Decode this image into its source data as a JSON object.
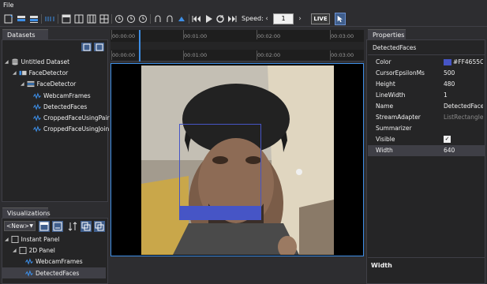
{
  "menu": {
    "file": "File"
  },
  "toolbar": {
    "speed_label": "Speed:",
    "speed_value": "1",
    "live_label": "LIVE"
  },
  "datasets_panel": {
    "tab": "Datasets",
    "tree": [
      {
        "label": "Untitled Dataset",
        "icon": "database-icon"
      },
      {
        "label": "FaceDetector",
        "icon": "session-icon"
      },
      {
        "label": "FaceDetector",
        "icon": "partition-icon"
      },
      {
        "label": "WebcamFrames",
        "icon": "stream-icon"
      },
      {
        "label": "DetectedFaces",
        "icon": "stream-icon"
      },
      {
        "label": "CroppedFaceUsingPair",
        "icon": "stream-icon"
      },
      {
        "label": "CroppedFaceUsingJoin",
        "icon": "stream-icon"
      }
    ]
  },
  "visualizations_panel": {
    "tab": "Visualizations",
    "new_dropdown": "<New>",
    "tree": [
      {
        "label": "Instant Panel"
      },
      {
        "label": "2D Panel"
      },
      {
        "label": "WebcamFrames"
      },
      {
        "label": "DetectedFaces"
      }
    ]
  },
  "timeline": {
    "top_ticks": [
      "00:00:00",
      "00:01:00",
      "00:02:00",
      "00:03:00"
    ],
    "bottom_ticks": [
      "00:00:00",
      "00:01:00",
      "00:02:00",
      "00:03:00"
    ]
  },
  "properties_panel": {
    "tab": "Properties",
    "object": "DetectedFaces",
    "rows": [
      {
        "key": "Color",
        "value": "#FF4655C6"
      },
      {
        "key": "CursorEpsilonMs",
        "value": "500"
      },
      {
        "key": "Height",
        "value": "480"
      },
      {
        "key": "LineWidth",
        "value": "1"
      },
      {
        "key": "Name",
        "value": "DetectedFaces"
      },
      {
        "key": "StreamAdapter",
        "value": "ListRectangle..."
      },
      {
        "key": "Summarizer",
        "value": ""
      },
      {
        "key": "Visible",
        "value": "✓"
      },
      {
        "key": "Width",
        "value": "640"
      }
    ],
    "description_title": "Width"
  },
  "colors": {
    "accent": "#3d8ee6",
    "detection_box": "#4655c6"
  }
}
